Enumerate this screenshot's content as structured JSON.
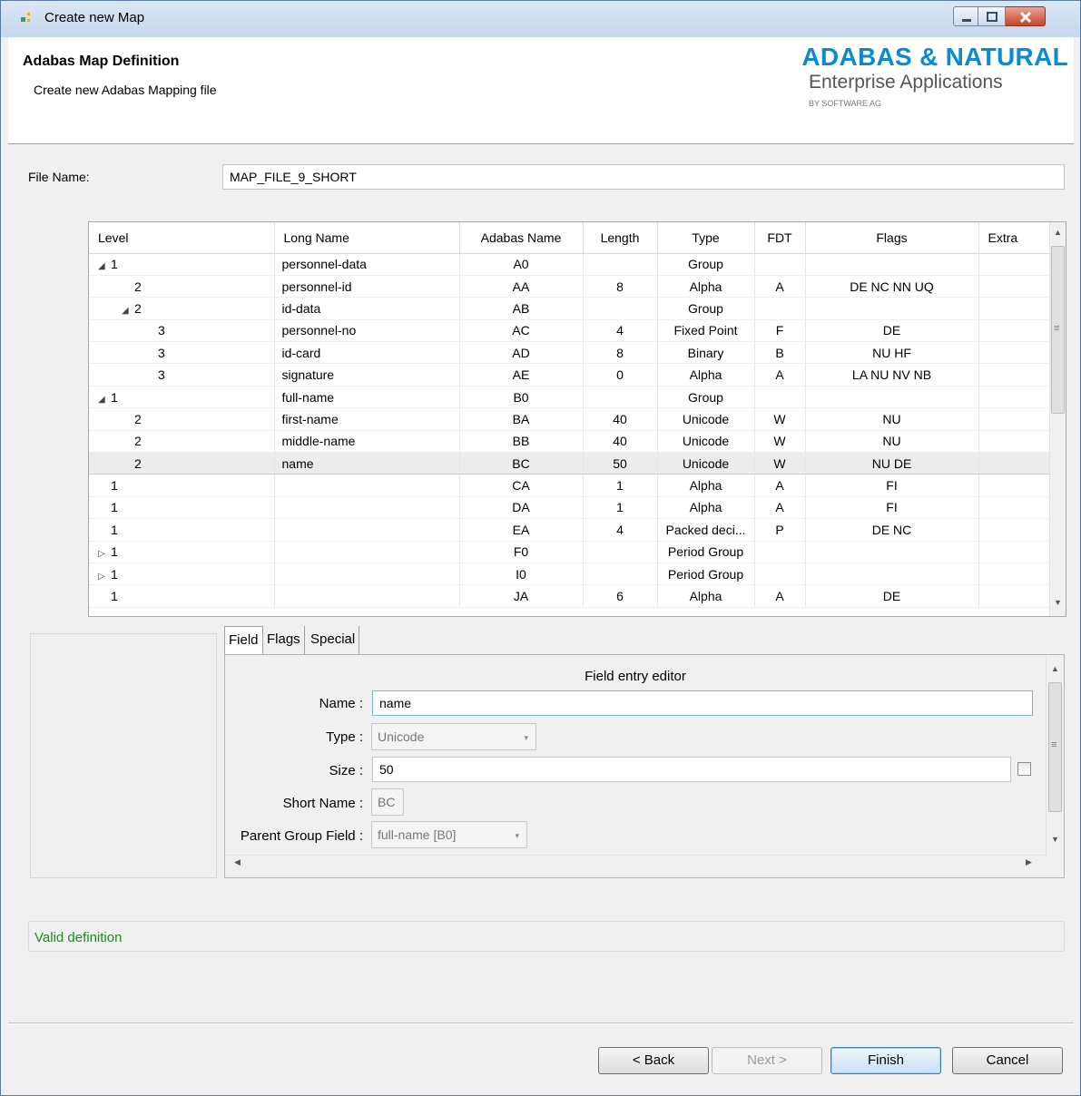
{
  "window": {
    "title": "Create new Map"
  },
  "header": {
    "title": "Adabas Map Definition",
    "subtitle": "Create new Adabas Mapping file",
    "logo_main": "ADABAS & NATURAL",
    "logo_sub": "Enterprise Applications",
    "logo_by": "BY SOFTWARE AG"
  },
  "file": {
    "label": "File Name:",
    "value": "MAP_FILE_9_SHORT"
  },
  "table": {
    "columns": [
      "Level",
      "Long Name",
      "Adabas Name",
      "Length",
      "Type",
      "FDT",
      "Flags",
      "Extra"
    ],
    "rows": [
      {
        "tw": "◢",
        "level": "1",
        "long": "personnel-data",
        "ada": "A0",
        "len": "",
        "type": "Group",
        "fdt": "",
        "flags": "",
        "indent": 0
      },
      {
        "tw": "",
        "level": "2",
        "long": "personnel-id",
        "ada": "AA",
        "len": "8",
        "type": "Alpha",
        "fdt": "A",
        "flags": "DE NC NN UQ",
        "indent": 1
      },
      {
        "tw": "◢",
        "level": "2",
        "long": "id-data",
        "ada": "AB",
        "len": "",
        "type": "Group",
        "fdt": "",
        "flags": "",
        "indent": 1
      },
      {
        "tw": "",
        "level": "3",
        "long": "personnel-no",
        "ada": "AC",
        "len": "4",
        "type": "Fixed Point",
        "fdt": "F",
        "flags": "DE",
        "indent": 2
      },
      {
        "tw": "",
        "level": "3",
        "long": "id-card",
        "ada": "AD",
        "len": "8",
        "type": "Binary",
        "fdt": "B",
        "flags": "NU HF",
        "indent": 2
      },
      {
        "tw": "",
        "level": "3",
        "long": "signature",
        "ada": "AE",
        "len": "0",
        "type": "Alpha",
        "fdt": "A",
        "flags": "LA NU NV NB",
        "indent": 2
      },
      {
        "tw": "◢",
        "level": "1",
        "long": "full-name",
        "ada": "B0",
        "len": "",
        "type": "Group",
        "fdt": "",
        "flags": "",
        "indent": 0
      },
      {
        "tw": "",
        "level": "2",
        "long": "first-name",
        "ada": "BA",
        "len": "40",
        "type": "Unicode",
        "fdt": "W",
        "flags": "NU",
        "indent": 1
      },
      {
        "tw": "",
        "level": "2",
        "long": "middle-name",
        "ada": "BB",
        "len": "40",
        "type": "Unicode",
        "fdt": "W",
        "flags": "NU",
        "indent": 1
      },
      {
        "tw": "",
        "level": "2",
        "long": "name",
        "ada": "BC",
        "len": "50",
        "type": "Unicode",
        "fdt": "W",
        "flags": "NU DE",
        "indent": 1,
        "selected": true
      },
      {
        "tw": "",
        "level": "1",
        "long": "",
        "ada": "CA",
        "len": "1",
        "type": "Alpha",
        "fdt": "A",
        "flags": "FI",
        "indent": 0
      },
      {
        "tw": "",
        "level": "1",
        "long": "",
        "ada": "DA",
        "len": "1",
        "type": "Alpha",
        "fdt": "A",
        "flags": "FI",
        "indent": 0
      },
      {
        "tw": "",
        "level": "1",
        "long": "",
        "ada": "EA",
        "len": "4",
        "type": "Packed deci...",
        "fdt": "P",
        "flags": "DE NC",
        "indent": 0
      },
      {
        "tw": "▷",
        "level": "1",
        "long": "",
        "ada": "F0",
        "len": "",
        "type": "Period Group",
        "fdt": "",
        "flags": "",
        "indent": 0
      },
      {
        "tw": "▷",
        "level": "1",
        "long": "",
        "ada": "I0",
        "len": "",
        "type": "Period Group",
        "fdt": "",
        "flags": "",
        "indent": 0
      },
      {
        "tw": "",
        "level": "1",
        "long": "",
        "ada": "JA",
        "len": "6",
        "type": "Alpha",
        "fdt": "A",
        "flags": "DE",
        "indent": 0
      }
    ]
  },
  "tabs": [
    "Field",
    "Flags",
    "Special"
  ],
  "editor": {
    "title": "Field entry editor",
    "name_label": "Name :",
    "name_value": "name",
    "type_label": "Type :",
    "type_value": "Unicode",
    "size_label": "Size :",
    "size_value": "50",
    "short_label": "Short Name :",
    "short_value": "BC",
    "parent_label": "Parent Group Field :",
    "parent_value": "full-name [B0]"
  },
  "status": {
    "text": "Valid definition",
    "color": "#1b8a1b"
  },
  "buttons": {
    "back": "< Back",
    "next": "Next >",
    "finish": "Finish",
    "cancel": "Cancel"
  },
  "icons": {
    "dropdown": "▾",
    "scroll_up": "▲",
    "scroll_down": "▼",
    "scroll_left": "◀",
    "scroll_right": "▶",
    "scroll_grip": "≡"
  }
}
